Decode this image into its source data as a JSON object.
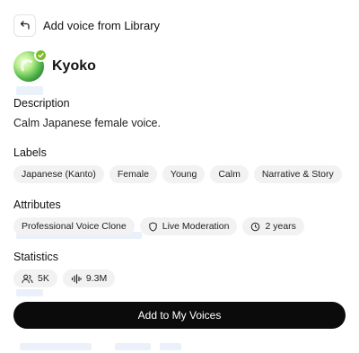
{
  "header": {
    "title": "Add voice from Library"
  },
  "voice": {
    "name": "Kyoko",
    "verified": true
  },
  "description": {
    "heading": "Description",
    "text": "Calm Japanese female voice."
  },
  "labels": {
    "heading": "Labels",
    "items": [
      "Japanese (Kanto)",
      "Female",
      "Young",
      "Calm",
      "Narrative & Story"
    ]
  },
  "attributes": {
    "heading": "Attributes",
    "items": [
      {
        "label": "Professional Voice Clone",
        "icon": ""
      },
      {
        "label": "Live Moderation",
        "icon": "shield-icon"
      },
      {
        "label": "2 years",
        "icon": "clock-icon"
      }
    ]
  },
  "statistics": {
    "heading": "Statistics",
    "users": {
      "value": "5K",
      "icon": "users-icon"
    },
    "plays": {
      "value": "9.3M",
      "icon": "waveform-icon"
    }
  },
  "cta": {
    "label": "Add to My Voices"
  },
  "colors": {
    "primary_button": "#0b0b0b",
    "chip_bg": "#f2f2f2",
    "verified_badge": "#7cbc2e"
  }
}
